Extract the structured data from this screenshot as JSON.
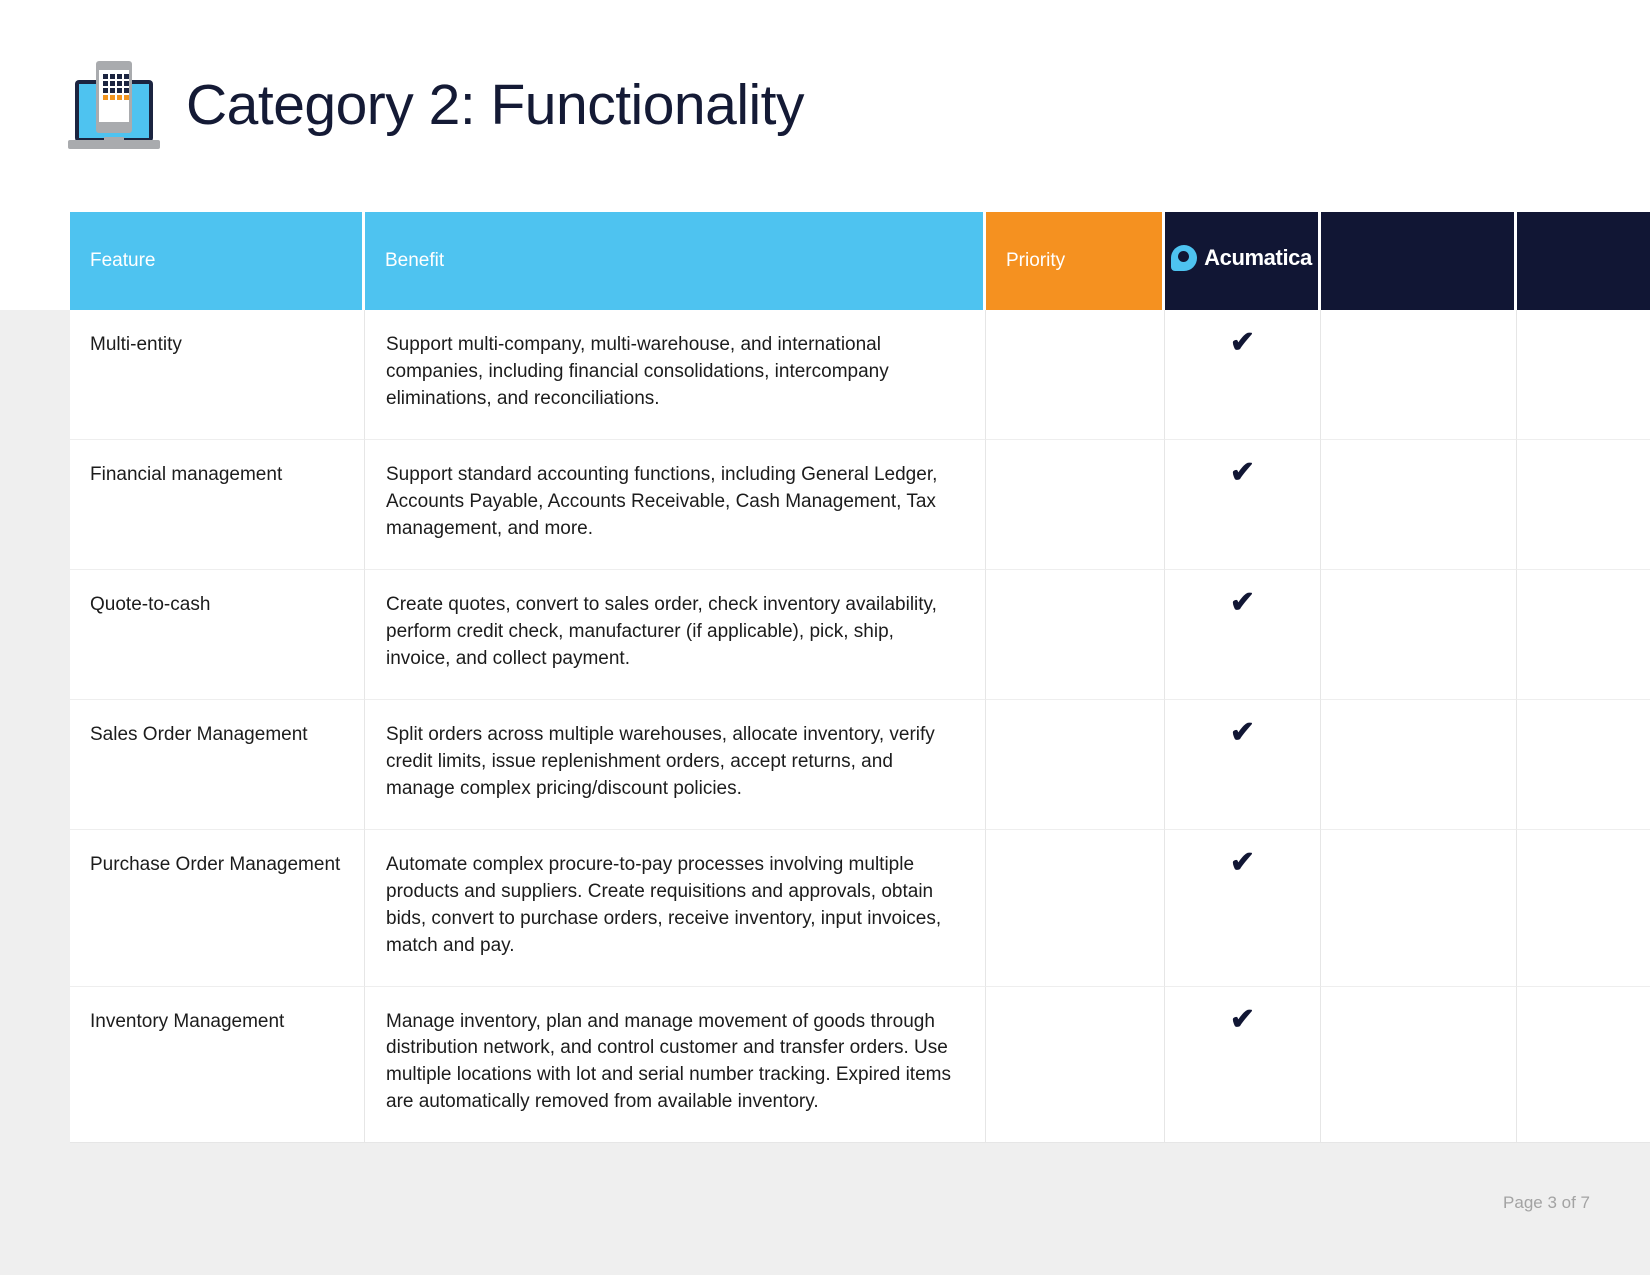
{
  "header": {
    "title": "Category 2: Functionality",
    "icon": "laptop-mobile-icon"
  },
  "colors": {
    "header_blue": "#4ec3f0",
    "header_orange": "#f59120",
    "header_navy": "#111634",
    "page_grey": "#efefef",
    "check_navy": "#111634"
  },
  "table": {
    "columns": [
      {
        "key": "feature",
        "label": "Feature",
        "style": "blue"
      },
      {
        "key": "benefit",
        "label": "Benefit",
        "style": "blue"
      },
      {
        "key": "priority",
        "label": "Priority",
        "style": "orange"
      },
      {
        "key": "vendor1",
        "label": "Acumatica",
        "style": "navy-logo"
      },
      {
        "key": "vendor2",
        "label": "",
        "style": "navy"
      },
      {
        "key": "vendor3",
        "label": "",
        "style": "navy"
      }
    ],
    "logo_text": "Acumatica",
    "check_glyph": "✔",
    "rows": [
      {
        "feature": "Multi-entity",
        "benefit": "Support multi-company, multi-warehouse, and international companies, including financial consolidations, intercompany eliminations, and reconciliations.",
        "priority": "",
        "vendor1": true,
        "vendor2": false,
        "vendor3": false
      },
      {
        "feature": "Financial management",
        "benefit": "Support standard accounting functions, including General Ledger, Accounts Payable, Accounts Receivable, Cash Management, Tax management, and more.",
        "priority": "",
        "vendor1": true,
        "vendor2": false,
        "vendor3": false
      },
      {
        "feature": "Quote-to-cash",
        "benefit": "Create quotes, convert to sales order, check inventory availability, perform credit check, manufacturer (if applicable), pick, ship, invoice, and collect payment.",
        "priority": "",
        "vendor1": true,
        "vendor2": false,
        "vendor3": false
      },
      {
        "feature": "Sales Order Management",
        "benefit": "Split orders across multiple warehouses, allocate inventory, verify credit limits, issue replenishment orders, accept returns, and manage complex pricing/discount policies.",
        "priority": "",
        "vendor1": true,
        "vendor2": false,
        "vendor3": false
      },
      {
        "feature": "Purchase Order Management",
        "benefit": "Automate complex procure-to-pay processes involving multiple products and suppliers. Create requisitions and approvals, obtain bids, convert to purchase orders, receive inventory, input invoices, match and pay.",
        "priority": "",
        "vendor1": true,
        "vendor2": false,
        "vendor3": false
      },
      {
        "feature": "Inventory Management",
        "benefit": "Manage inventory, plan and manage movement of goods through distribution network, and control customer and transfer orders. Use multiple locations with lot and serial number tracking. Expired items are automatically removed from available inventory.",
        "priority": "",
        "vendor1": true,
        "vendor2": false,
        "vendor3": false
      }
    ]
  },
  "footer": {
    "page_label": "Page 3 of 7"
  }
}
